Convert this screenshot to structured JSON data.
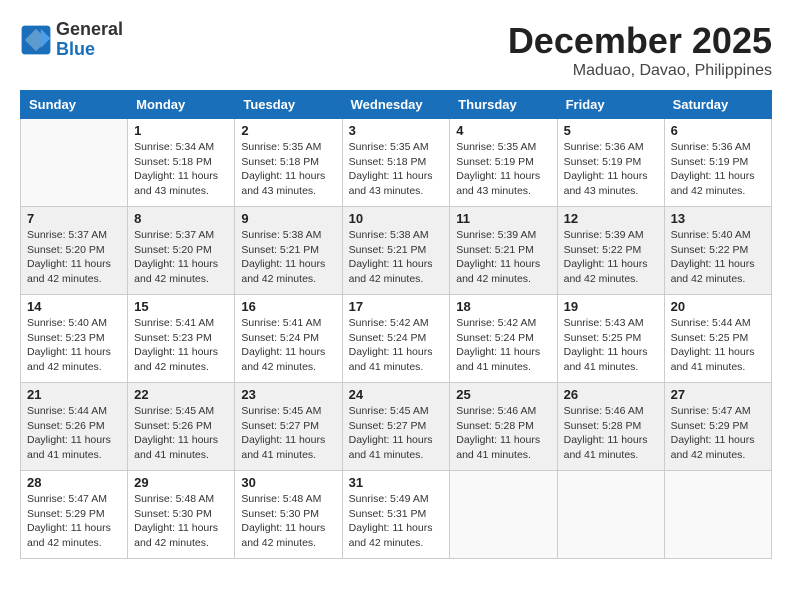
{
  "header": {
    "logo_line1": "General",
    "logo_line2": "Blue",
    "month_year": "December 2025",
    "location": "Maduao, Davao, Philippines"
  },
  "days_of_week": [
    "Sunday",
    "Monday",
    "Tuesday",
    "Wednesday",
    "Thursday",
    "Friday",
    "Saturday"
  ],
  "weeks": [
    [
      {
        "day": "",
        "sunrise": "",
        "sunset": "",
        "daylight": ""
      },
      {
        "day": "1",
        "sunrise": "Sunrise: 5:34 AM",
        "sunset": "Sunset: 5:18 PM",
        "daylight": "Daylight: 11 hours and 43 minutes."
      },
      {
        "day": "2",
        "sunrise": "Sunrise: 5:35 AM",
        "sunset": "Sunset: 5:18 PM",
        "daylight": "Daylight: 11 hours and 43 minutes."
      },
      {
        "day": "3",
        "sunrise": "Sunrise: 5:35 AM",
        "sunset": "Sunset: 5:18 PM",
        "daylight": "Daylight: 11 hours and 43 minutes."
      },
      {
        "day": "4",
        "sunrise": "Sunrise: 5:35 AM",
        "sunset": "Sunset: 5:19 PM",
        "daylight": "Daylight: 11 hours and 43 minutes."
      },
      {
        "day": "5",
        "sunrise": "Sunrise: 5:36 AM",
        "sunset": "Sunset: 5:19 PM",
        "daylight": "Daylight: 11 hours and 43 minutes."
      },
      {
        "day": "6",
        "sunrise": "Sunrise: 5:36 AM",
        "sunset": "Sunset: 5:19 PM",
        "daylight": "Daylight: 11 hours and 42 minutes."
      }
    ],
    [
      {
        "day": "7",
        "sunrise": "Sunrise: 5:37 AM",
        "sunset": "Sunset: 5:20 PM",
        "daylight": "Daylight: 11 hours and 42 minutes."
      },
      {
        "day": "8",
        "sunrise": "Sunrise: 5:37 AM",
        "sunset": "Sunset: 5:20 PM",
        "daylight": "Daylight: 11 hours and 42 minutes."
      },
      {
        "day": "9",
        "sunrise": "Sunrise: 5:38 AM",
        "sunset": "Sunset: 5:21 PM",
        "daylight": "Daylight: 11 hours and 42 minutes."
      },
      {
        "day": "10",
        "sunrise": "Sunrise: 5:38 AM",
        "sunset": "Sunset: 5:21 PM",
        "daylight": "Daylight: 11 hours and 42 minutes."
      },
      {
        "day": "11",
        "sunrise": "Sunrise: 5:39 AM",
        "sunset": "Sunset: 5:21 PM",
        "daylight": "Daylight: 11 hours and 42 minutes."
      },
      {
        "day": "12",
        "sunrise": "Sunrise: 5:39 AM",
        "sunset": "Sunset: 5:22 PM",
        "daylight": "Daylight: 11 hours and 42 minutes."
      },
      {
        "day": "13",
        "sunrise": "Sunrise: 5:40 AM",
        "sunset": "Sunset: 5:22 PM",
        "daylight": "Daylight: 11 hours and 42 minutes."
      }
    ],
    [
      {
        "day": "14",
        "sunrise": "Sunrise: 5:40 AM",
        "sunset": "Sunset: 5:23 PM",
        "daylight": "Daylight: 11 hours and 42 minutes."
      },
      {
        "day": "15",
        "sunrise": "Sunrise: 5:41 AM",
        "sunset": "Sunset: 5:23 PM",
        "daylight": "Daylight: 11 hours and 42 minutes."
      },
      {
        "day": "16",
        "sunrise": "Sunrise: 5:41 AM",
        "sunset": "Sunset: 5:24 PM",
        "daylight": "Daylight: 11 hours and 42 minutes."
      },
      {
        "day": "17",
        "sunrise": "Sunrise: 5:42 AM",
        "sunset": "Sunset: 5:24 PM",
        "daylight": "Daylight: 11 hours and 41 minutes."
      },
      {
        "day": "18",
        "sunrise": "Sunrise: 5:42 AM",
        "sunset": "Sunset: 5:24 PM",
        "daylight": "Daylight: 11 hours and 41 minutes."
      },
      {
        "day": "19",
        "sunrise": "Sunrise: 5:43 AM",
        "sunset": "Sunset: 5:25 PM",
        "daylight": "Daylight: 11 hours and 41 minutes."
      },
      {
        "day": "20",
        "sunrise": "Sunrise: 5:44 AM",
        "sunset": "Sunset: 5:25 PM",
        "daylight": "Daylight: 11 hours and 41 minutes."
      }
    ],
    [
      {
        "day": "21",
        "sunrise": "Sunrise: 5:44 AM",
        "sunset": "Sunset: 5:26 PM",
        "daylight": "Daylight: 11 hours and 41 minutes."
      },
      {
        "day": "22",
        "sunrise": "Sunrise: 5:45 AM",
        "sunset": "Sunset: 5:26 PM",
        "daylight": "Daylight: 11 hours and 41 minutes."
      },
      {
        "day": "23",
        "sunrise": "Sunrise: 5:45 AM",
        "sunset": "Sunset: 5:27 PM",
        "daylight": "Daylight: 11 hours and 41 minutes."
      },
      {
        "day": "24",
        "sunrise": "Sunrise: 5:45 AM",
        "sunset": "Sunset: 5:27 PM",
        "daylight": "Daylight: 11 hours and 41 minutes."
      },
      {
        "day": "25",
        "sunrise": "Sunrise: 5:46 AM",
        "sunset": "Sunset: 5:28 PM",
        "daylight": "Daylight: 11 hours and 41 minutes."
      },
      {
        "day": "26",
        "sunrise": "Sunrise: 5:46 AM",
        "sunset": "Sunset: 5:28 PM",
        "daylight": "Daylight: 11 hours and 41 minutes."
      },
      {
        "day": "27",
        "sunrise": "Sunrise: 5:47 AM",
        "sunset": "Sunset: 5:29 PM",
        "daylight": "Daylight: 11 hours and 42 minutes."
      }
    ],
    [
      {
        "day": "28",
        "sunrise": "Sunrise: 5:47 AM",
        "sunset": "Sunset: 5:29 PM",
        "daylight": "Daylight: 11 hours and 42 minutes."
      },
      {
        "day": "29",
        "sunrise": "Sunrise: 5:48 AM",
        "sunset": "Sunset: 5:30 PM",
        "daylight": "Daylight: 11 hours and 42 minutes."
      },
      {
        "day": "30",
        "sunrise": "Sunrise: 5:48 AM",
        "sunset": "Sunset: 5:30 PM",
        "daylight": "Daylight: 11 hours and 42 minutes."
      },
      {
        "day": "31",
        "sunrise": "Sunrise: 5:49 AM",
        "sunset": "Sunset: 5:31 PM",
        "daylight": "Daylight: 11 hours and 42 minutes."
      },
      {
        "day": "",
        "sunrise": "",
        "sunset": "",
        "daylight": ""
      },
      {
        "day": "",
        "sunrise": "",
        "sunset": "",
        "daylight": ""
      },
      {
        "day": "",
        "sunrise": "",
        "sunset": "",
        "daylight": ""
      }
    ]
  ]
}
